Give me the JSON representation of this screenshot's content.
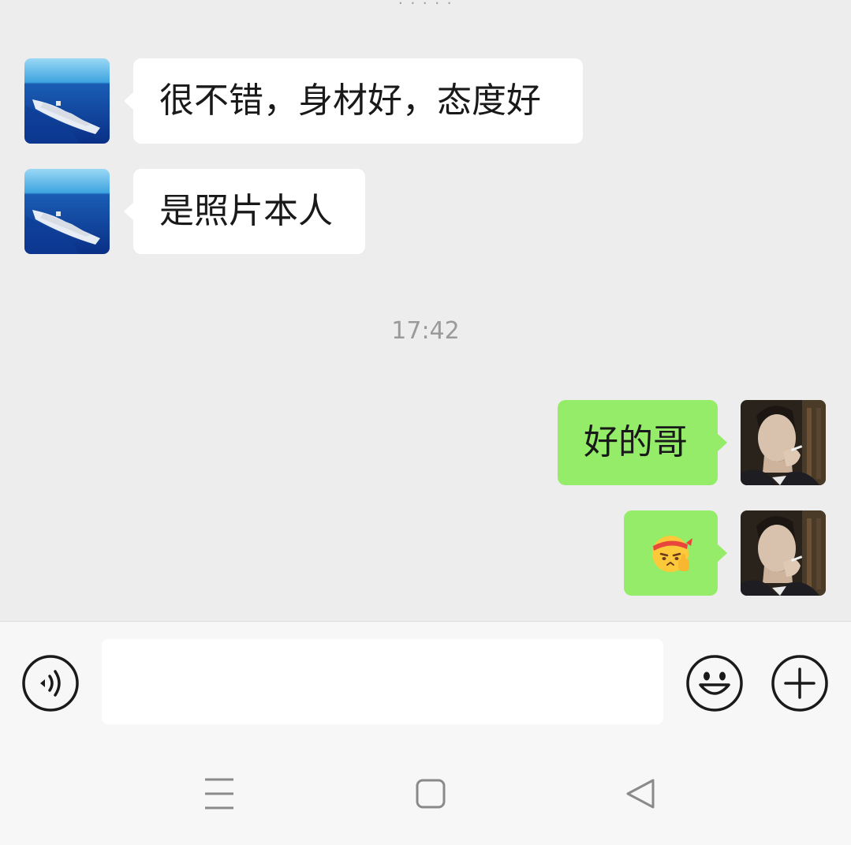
{
  "colors": {
    "background": "#ededed",
    "incoming_bubble": "#ffffff",
    "outgoing_bubble": "#95ec69",
    "timestamp": "#9a9a9a",
    "input_bar": "#f7f7f7"
  },
  "messages": [
    {
      "side": "incoming",
      "avatar": "ship-avatar",
      "text": "很不错，身材好，态度好"
    },
    {
      "side": "incoming",
      "avatar": "ship-avatar",
      "text": "是照片本人"
    },
    {
      "side": "outgoing",
      "avatar": "man-smoking-avatar",
      "text": "好的哥"
    },
    {
      "side": "outgoing",
      "avatar": "man-smoking-avatar",
      "emoji": "salute-headband-emoji"
    }
  ],
  "timestamp": "17:42",
  "input": {
    "value": "",
    "placeholder": "",
    "voice_icon": "voice-icon",
    "emoji_icon": "smiley-icon",
    "more_icon": "plus-icon"
  },
  "nav": {
    "menu_icon": "menu-icon",
    "home_icon": "home-icon",
    "back_icon": "back-icon"
  }
}
